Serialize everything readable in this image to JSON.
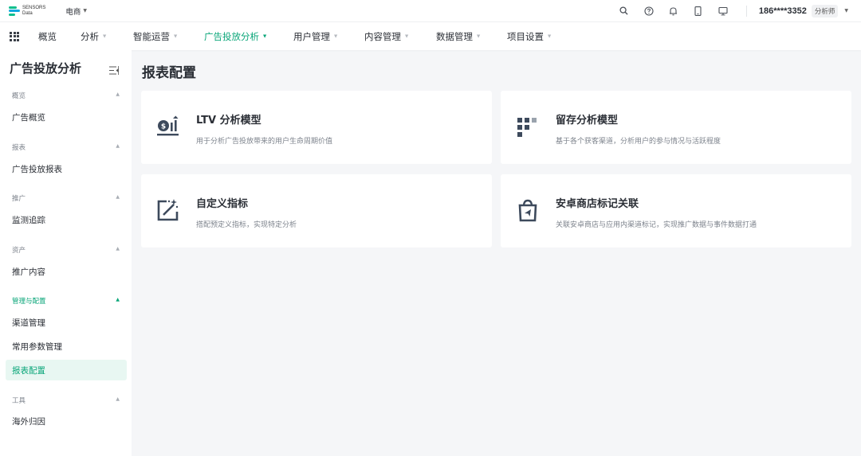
{
  "brand": {
    "line1": "SENSORS",
    "line2": "Data"
  },
  "project": {
    "name": "电商"
  },
  "user": {
    "phone": "186****3352",
    "role": "分析师"
  },
  "nav": {
    "items": [
      {
        "label": "概览",
        "active": false,
        "has_menu": false
      },
      {
        "label": "分析",
        "active": false,
        "has_menu": true
      },
      {
        "label": "智能运营",
        "active": false,
        "has_menu": true
      },
      {
        "label": "广告投放分析",
        "active": true,
        "has_menu": true
      },
      {
        "label": "用户管理",
        "active": false,
        "has_menu": true
      },
      {
        "label": "内容管理",
        "active": false,
        "has_menu": true
      },
      {
        "label": "数据管理",
        "active": false,
        "has_menu": true
      },
      {
        "label": "项目设置",
        "active": false,
        "has_menu": true
      }
    ]
  },
  "sidebar": {
    "title": "广告投放分析",
    "groups": [
      {
        "label": "概览",
        "items": [
          "广告概览"
        ]
      },
      {
        "label": "报表",
        "items": [
          "广告投放报表"
        ]
      },
      {
        "label": "推广",
        "items": [
          "监测追踪"
        ]
      },
      {
        "label": "资产",
        "items": [
          "推广内容"
        ]
      },
      {
        "label": "管理与配置",
        "items": [
          "渠道管理",
          "常用参数管理",
          "报表配置"
        ]
      },
      {
        "label": "工具",
        "items": [
          "海外归因"
        ]
      }
    ],
    "active_item": "报表配置"
  },
  "main": {
    "title": "报表配置",
    "cards": [
      {
        "title": "LTV 分析模型",
        "desc": "用于分析广告投放带来的用户生命周期价值",
        "icon": "ltv-icon"
      },
      {
        "title": "留存分析模型",
        "desc": "基于各个获客渠道，分析用户的参与情况与活跃程度",
        "icon": "retention-icon"
      },
      {
        "title": "自定义指标",
        "desc": "搭配预定义指标，实现特定分析",
        "icon": "custom-metric-icon"
      },
      {
        "title": "安卓商店标记关联",
        "desc": "关联安卓商店与应用内渠道标记，实现推广数据与事件数据打通",
        "icon": "android-store-icon"
      }
    ]
  },
  "colors": {
    "accent": "#0aa679",
    "accent_bg": "#e8f7f2",
    "page_bg": "#f5f6f8",
    "icon_dark": "#3d4a5c"
  }
}
